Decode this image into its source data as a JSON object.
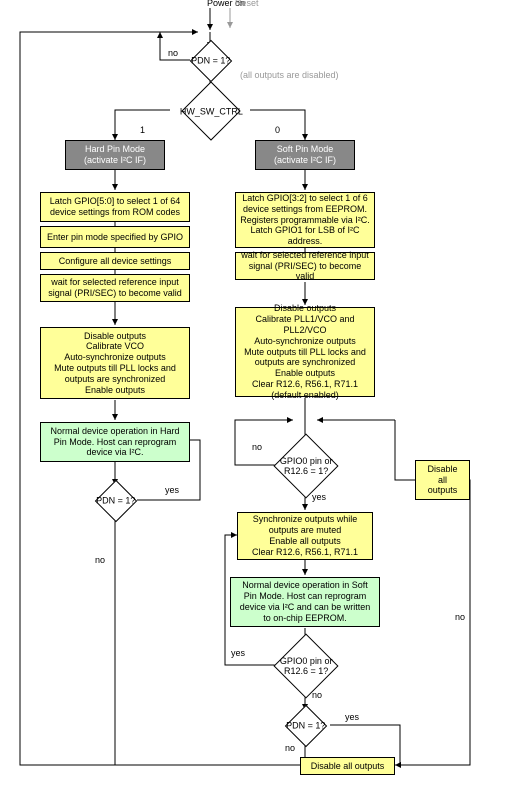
{
  "top": {
    "power_label": "Power on",
    "reset_label": "Reset",
    "pdn_q": "PDN = 1?",
    "all_disabled": "(all outputs are disabled)",
    "hw_sw": "HW_SW_CTRL",
    "no": "no",
    "yes": "yes",
    "one": "1",
    "zero": "0"
  },
  "hard": {
    "title_l1": "Hard Pin Mode",
    "title_l2": "(activate I²C IF)",
    "latch": "Latch GPIO[5:0] to select 1 of 64 device settings from ROM codes",
    "enter": "Enter pin mode specified by GPIO",
    "config": "Configure all device settings",
    "wait": "wait for selected reference input signal (PRI/SEC) to become valid",
    "cal": "Disable outputs\nCalibrate VCO\nAuto-synchronize outputs\nMute outputs till PLL locks and outputs are synchronized\nEnable outputs",
    "normal": "Normal device operation in Hard Pin Mode. Host can reprogram device via I²C.",
    "pdn_q": "PDN = 1?"
  },
  "soft": {
    "title_l1": "Soft Pin Mode",
    "title_l2": "(activate I²C IF)",
    "latch": "Latch GPIO[3:2] to select 1 of 6 device settings from EEPROM. Registers programmable via I²C. Latch GPIO1 for LSB of I²C address.",
    "wait": "wait for selected reference input signal (PRI/SEC) to become valid",
    "cal": "Disable outputs\nCalibrate PLL1/VCO and PLL2/VCO\nAuto-synchronize outputs\nMute outputs till PLL locks and outputs are synchronized\nEnable outputs\nClear R12.6, R56.1, R71.1\n(default enabled)",
    "gpio_q": "GPIO0 pin or\nR12.6 = 1?",
    "sync": "Synchronize outputs while outputs are muted\nEnable all outputs\nClear R12.6, R56.1, R71.1",
    "normal": "Normal device operation in Soft Pin Mode. Host can reprogram device via I²C and can be written to on-chip EEPROM.",
    "gpio_q2": "GPIO0 pin or\nR12.6 = 1?",
    "pdn_q": "PDN = 1?",
    "disable1": "Disable\nall\noutputs",
    "disable2": "Disable all outputs"
  }
}
